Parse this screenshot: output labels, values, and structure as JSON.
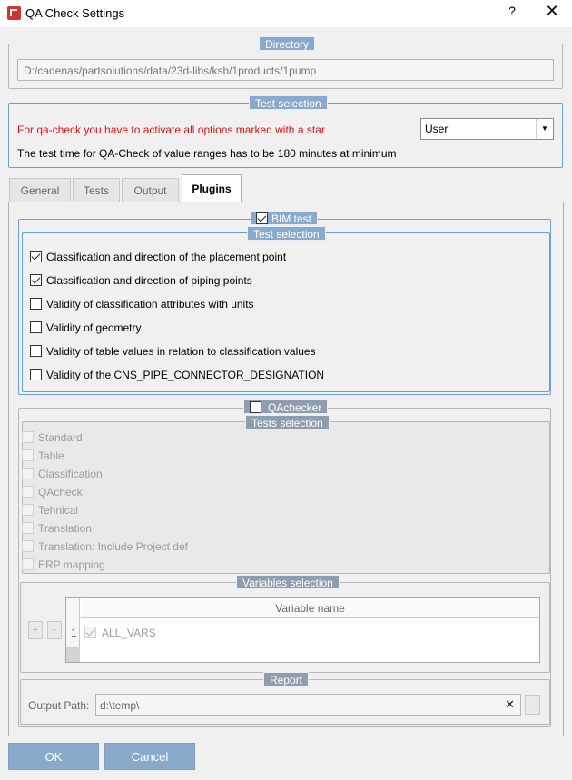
{
  "window": {
    "title": "QA Check Settings",
    "help_label": "?",
    "close_label": "✕",
    "icon": "app-logo-icon"
  },
  "directory": {
    "legend": "Directory",
    "path": "D:/cadenas/partsolutions/data/23d-libs/ksb/1products/1pump"
  },
  "test_selection": {
    "legend": "Test selection",
    "warning": "For qa-check you have to activate all options marked with a star",
    "info": "The test time for QA-Check of value ranges has to be 180 minutes at minimum",
    "user_select": "User",
    "warning_color": "#e01414"
  },
  "tabs": [
    {
      "label": "General",
      "active": false
    },
    {
      "label": "Tests",
      "active": false
    },
    {
      "label": "Output",
      "active": false
    },
    {
      "label": "Plugins",
      "active": true
    }
  ],
  "bim": {
    "label": "BIM test",
    "checked": true,
    "selection_legend": "Test selection",
    "items": [
      {
        "label": "Classification and direction of the placement point",
        "checked": true
      },
      {
        "label": "Classification and direction of piping points",
        "checked": true
      },
      {
        "label": "Validity of classification attributes with units",
        "checked": false
      },
      {
        "label": "Validity of geometry",
        "checked": false
      },
      {
        "label": "Validity of table values in relation to classification values",
        "checked": false
      },
      {
        "label": "Validity of the CNS_PIPE_CONNECTOR_DESIGNATION",
        "checked": false
      }
    ]
  },
  "qachecker": {
    "label": "QAchecker",
    "checked": false,
    "tests_legend": "Tests selection",
    "items": [
      "Standard",
      "Table",
      "Classification",
      "QAcheck",
      "Tehnical",
      "Translation",
      "Translation: Include Project def",
      "ERP mapping"
    ],
    "variables": {
      "legend": "Variables selection",
      "add_label": "+",
      "remove_label": "-",
      "column_header": "Variable name",
      "rows": [
        {
          "index": "1",
          "name": "ALL_VARS",
          "checked": true
        }
      ]
    },
    "report": {
      "legend": "Report",
      "output_label": "Output Path:",
      "output_value": "d:\\temp\\",
      "clear_label": "✕",
      "browse_label": "..."
    }
  },
  "buttons": {
    "ok": "OK",
    "cancel": "Cancel"
  },
  "colors": {
    "accent": "#8aaacb",
    "group_border_active": "#6f9fd2"
  }
}
